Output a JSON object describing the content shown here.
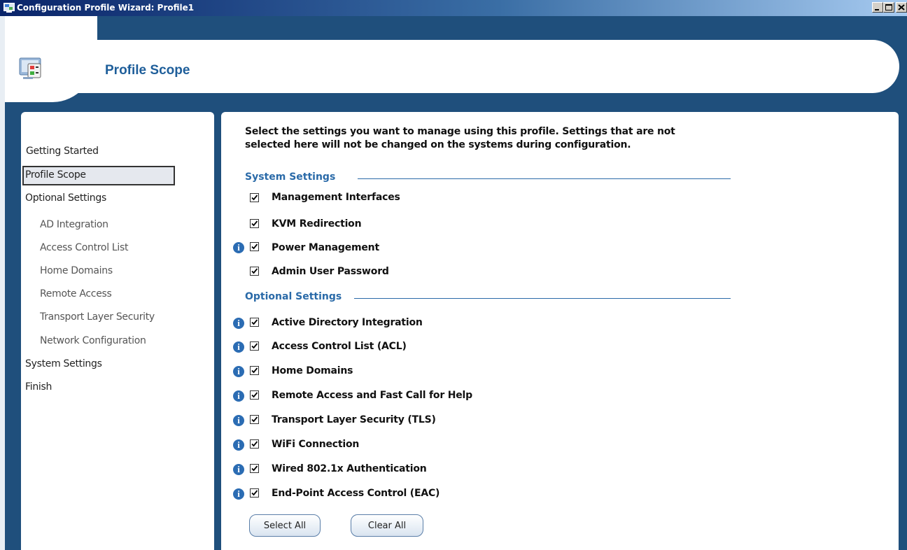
{
  "window": {
    "title": "Configuration Profile Wizard: Profile1",
    "controls": [
      "minimize",
      "maximize",
      "close"
    ]
  },
  "header": {
    "title": "Profile Scope",
    "icon": "wizard-computer-icon"
  },
  "sidebar": {
    "items": [
      {
        "label": "Getting Started",
        "level": 0,
        "selected": false
      },
      {
        "label": "Profile Scope",
        "level": 0,
        "selected": true
      },
      {
        "label": "Optional Settings",
        "level": 0,
        "selected": false
      },
      {
        "label": "AD Integration",
        "level": 1,
        "selected": false
      },
      {
        "label": "Access Control List",
        "level": 1,
        "selected": false
      },
      {
        "label": "Home Domains",
        "level": 1,
        "selected": false
      },
      {
        "label": "Remote Access",
        "level": 1,
        "selected": false
      },
      {
        "label": "Transport Layer Security",
        "level": 1,
        "selected": false
      },
      {
        "label": "Network Configuration",
        "level": 1,
        "selected": false
      },
      {
        "label": "System Settings",
        "level": 0,
        "selected": false
      },
      {
        "label": "Finish",
        "level": 0,
        "selected": false
      }
    ]
  },
  "main": {
    "intro_line1": "Select the settings you want to manage using this profile. Settings that are not",
    "intro_line2": "selected here will not be changed on the systems during configuration.",
    "system_section": {
      "title": "System Settings",
      "items": [
        {
          "label": "Management Interfaces",
          "checked": true,
          "info": false
        },
        {
          "label": "KVM Redirection",
          "checked": true,
          "info": false
        },
        {
          "label": "Power Management",
          "checked": true,
          "info": true
        },
        {
          "label": "Admin User Password",
          "checked": true,
          "info": false
        }
      ]
    },
    "optional_section": {
      "title": "Optional Settings",
      "items": [
        {
          "label": "Active Directory Integration",
          "checked": true,
          "info": true
        },
        {
          "label": "Access Control List (ACL)",
          "checked": true,
          "info": true
        },
        {
          "label": "Home Domains",
          "checked": true,
          "info": true
        },
        {
          "label": "Remote Access and Fast Call for Help",
          "checked": true,
          "info": true
        },
        {
          "label": "Transport Layer Security (TLS)",
          "checked": true,
          "info": true
        },
        {
          "label": "WiFi Connection",
          "checked": true,
          "info": true
        },
        {
          "label": "Wired 802.1x Authentication",
          "checked": true,
          "info": true
        },
        {
          "label": "End-Point Access Control (EAC)",
          "checked": true,
          "info": true
        }
      ]
    },
    "buttons": {
      "select_all": "Select All",
      "clear_all": "Clear All"
    }
  },
  "colors": {
    "frame_blue": "#1f4f7c",
    "heading_blue": "#1e5e9a",
    "section_blue": "#2a6aa8",
    "info_blue": "#2b6cb3"
  }
}
